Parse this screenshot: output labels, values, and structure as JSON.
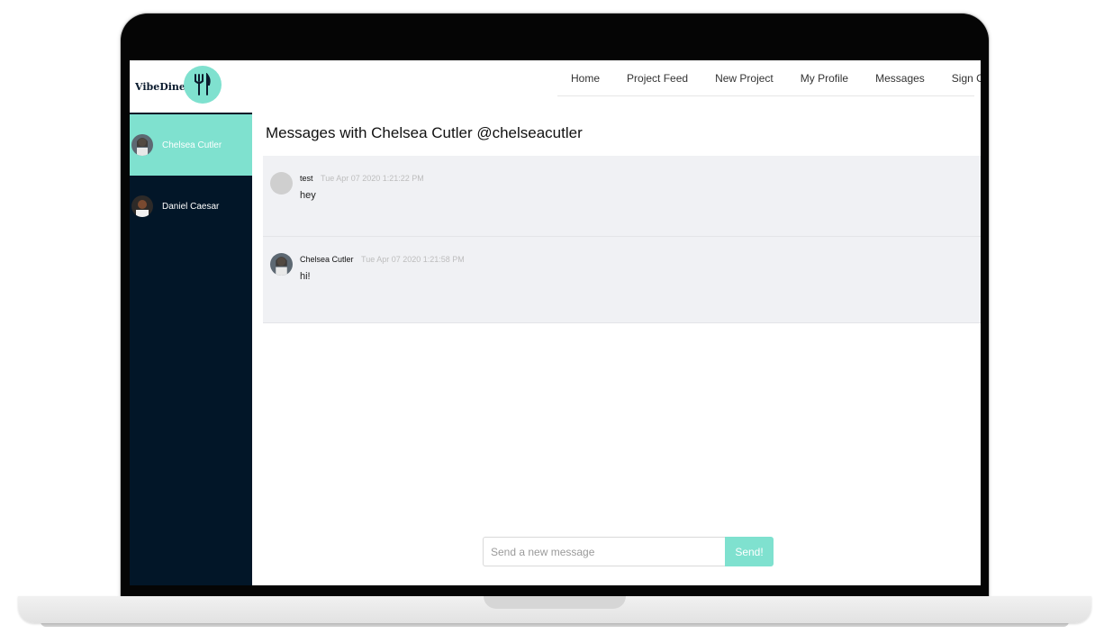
{
  "app": {
    "name": "VibeDiner",
    "logo_icon": "fork-knife-icon",
    "accent_color": "#7fe1cf",
    "sidebar_color": "#021628"
  },
  "nav": {
    "items": [
      {
        "label": "Home"
      },
      {
        "label": "Project Feed"
      },
      {
        "label": "New Project"
      },
      {
        "label": "My Profile"
      },
      {
        "label": "Messages"
      },
      {
        "label": "Sign Out"
      }
    ]
  },
  "sidebar": {
    "contacts": [
      {
        "name": "Chelsea Cutler",
        "active": true
      },
      {
        "name": "Daniel Caesar",
        "active": false
      }
    ]
  },
  "conversation": {
    "title": "Messages with Chelsea Cutler @chelseacutler",
    "messages": [
      {
        "author": "test",
        "time": "Tue Apr 07 2020 1:21:22 PM",
        "text": "hey"
      },
      {
        "author": "Chelsea Cutler",
        "time": "Tue Apr 07 2020 1:21:58 PM",
        "text": "hi!"
      }
    ]
  },
  "composer": {
    "placeholder": "Send a new message",
    "send_label": "Send!"
  }
}
